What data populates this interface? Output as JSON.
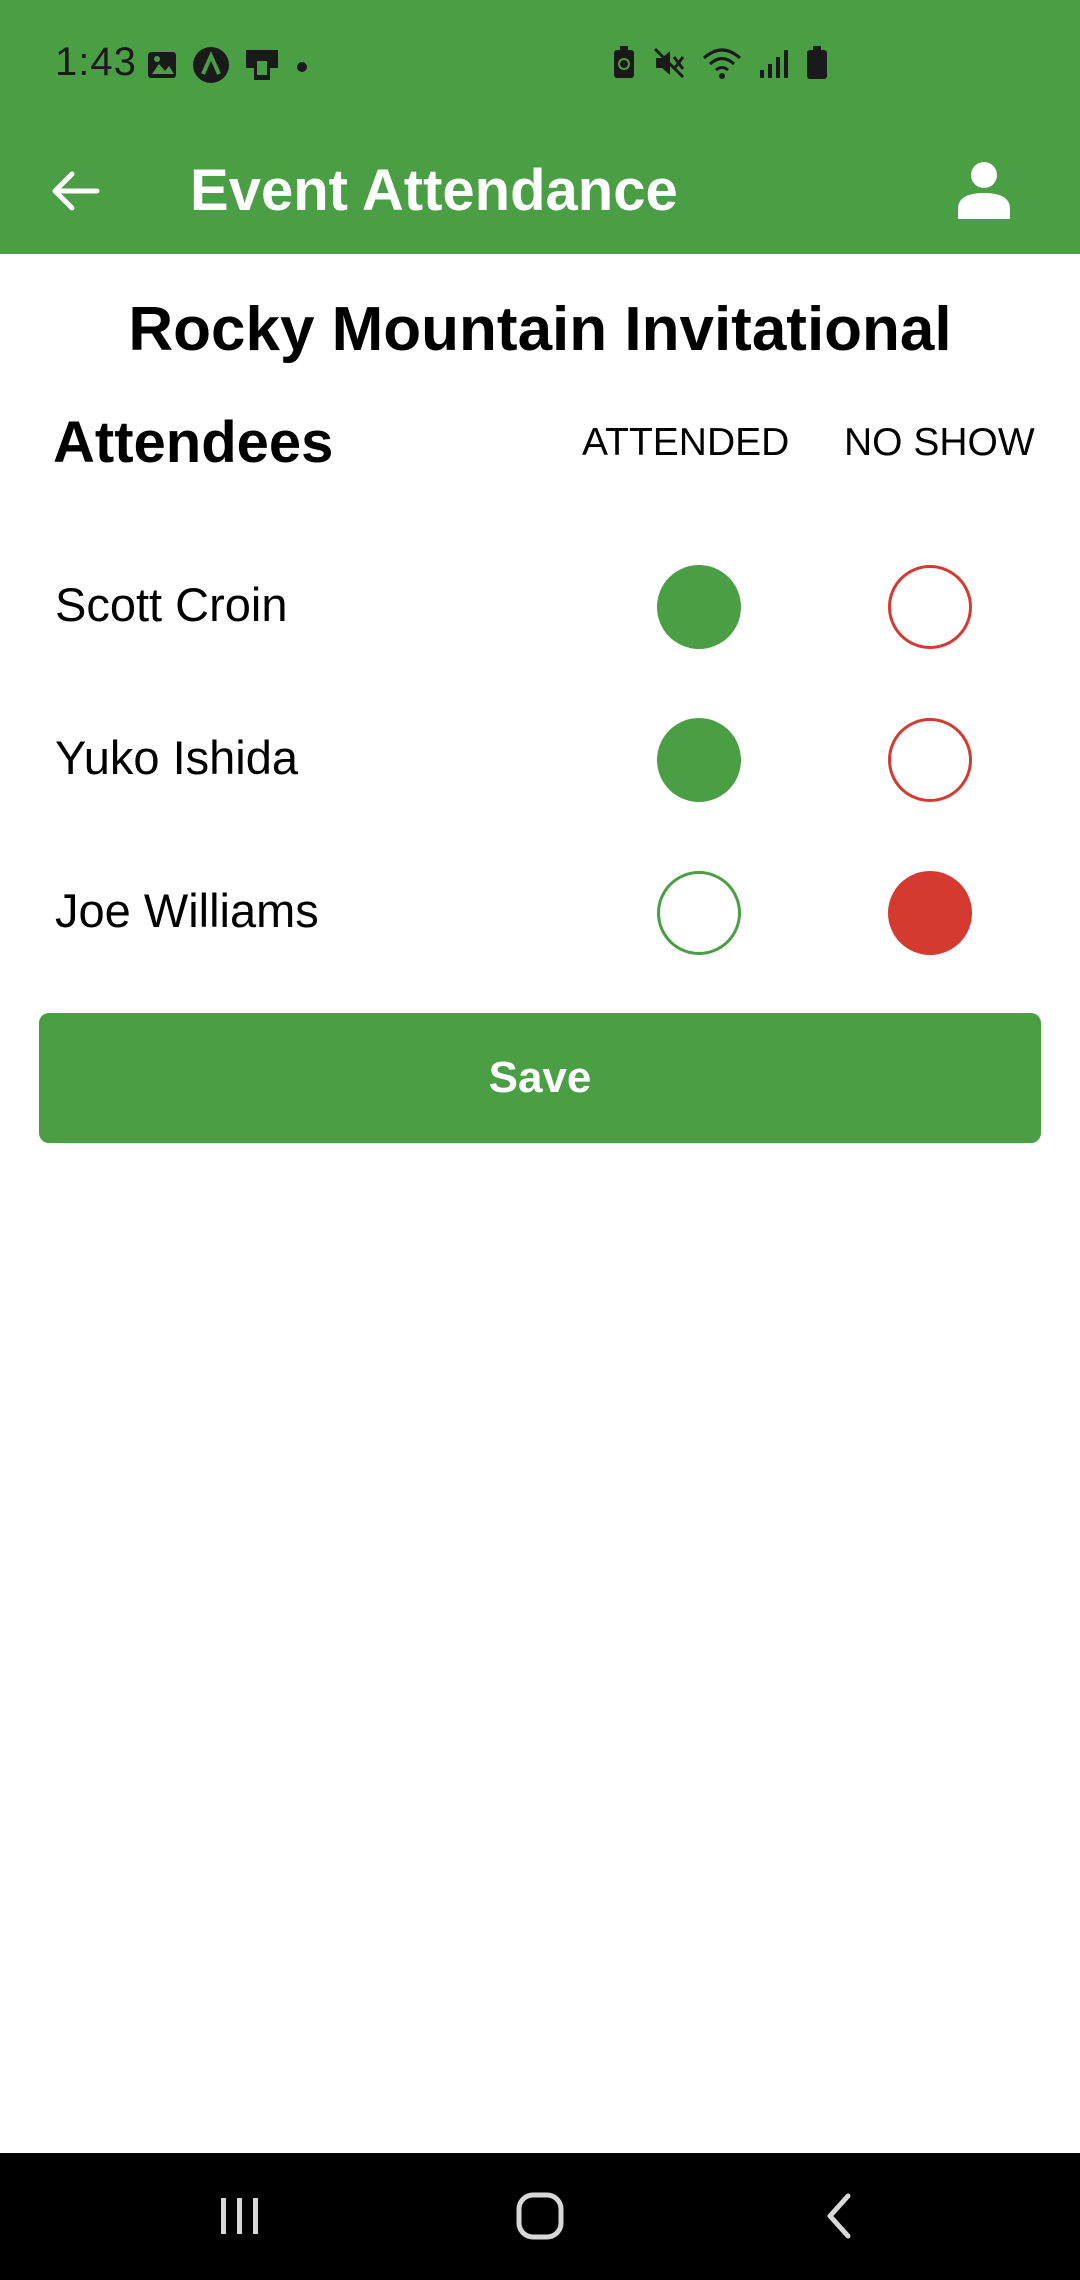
{
  "status_bar": {
    "time": "1:43",
    "left_icons": [
      "image-icon",
      "app-a-icon",
      "cast-icon",
      "dot-icon"
    ],
    "right_icons": [
      "battery-saver-icon",
      "mute-icon",
      "wifi-icon",
      "signal-icon",
      "battery-icon"
    ]
  },
  "app_bar": {
    "title": "Event Attendance",
    "back_icon": "arrow-back-icon",
    "profile_icon": "person-icon",
    "color": "#4a9e44"
  },
  "event": {
    "title": "Rocky Mountain Invitational"
  },
  "attendees": {
    "heading": "Attendees",
    "columns": {
      "attended": "ATTENDED",
      "no_show": "NO SHOW"
    },
    "rows": [
      {
        "name": "Scott Croin",
        "status": "attended"
      },
      {
        "name": "Yuko Ishida",
        "status": "attended"
      },
      {
        "name": "Joe Williams",
        "status": "no_show"
      }
    ]
  },
  "save": {
    "label": "Save"
  },
  "colors": {
    "attended": "#4a9e44",
    "no_show": "#d53a30"
  },
  "nav_bar": {
    "buttons": [
      "recent-apps-icon",
      "home-icon",
      "back-icon"
    ]
  }
}
